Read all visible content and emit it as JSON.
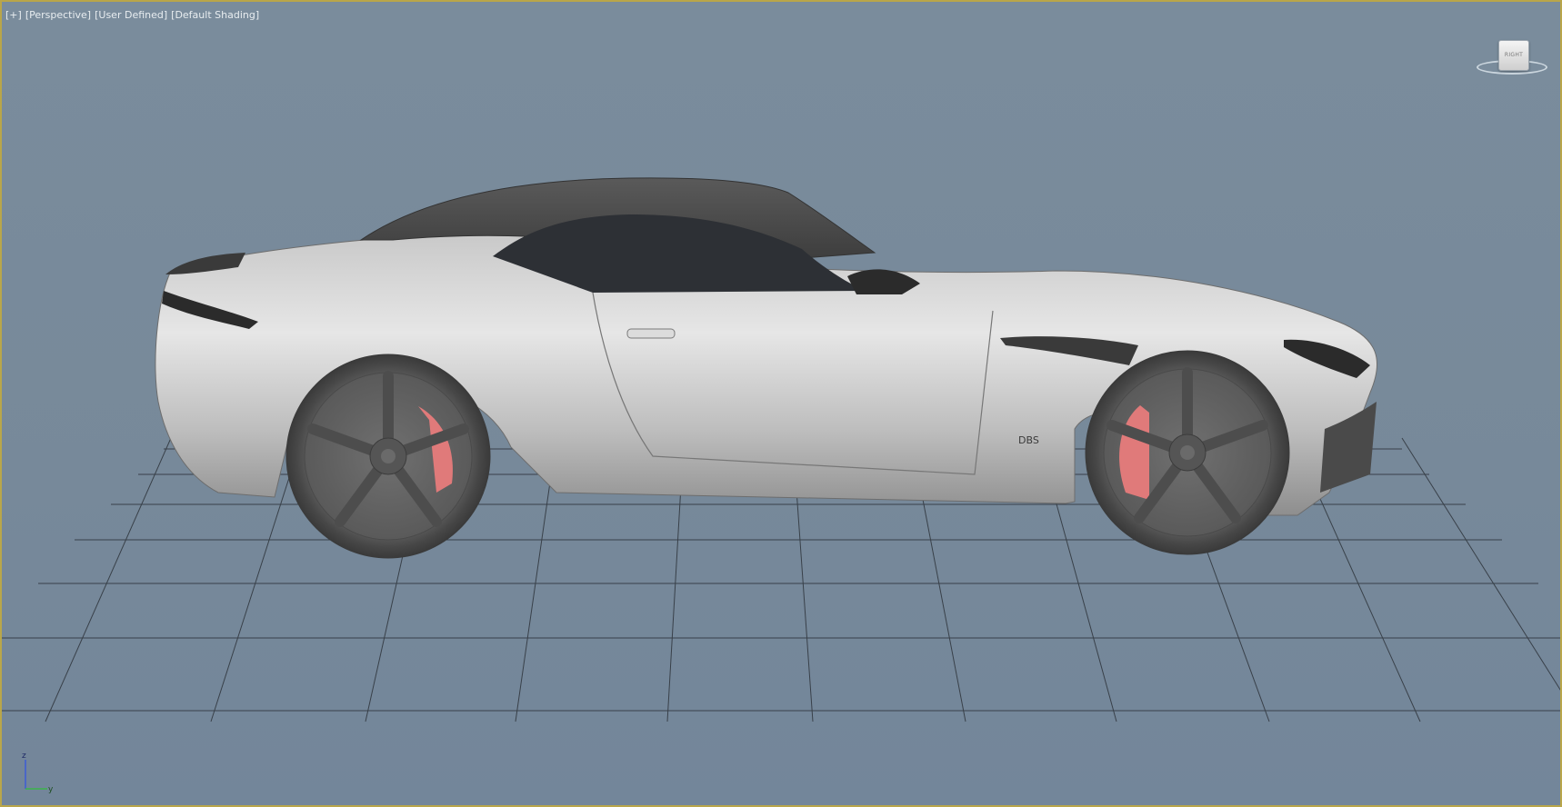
{
  "viewport": {
    "labels": [
      "[+]",
      "[Perspective]",
      "[User Defined]",
      "[Default Shading]"
    ]
  },
  "viewcube": {
    "face_label": "RIGHT"
  },
  "axis_gizmo": {
    "z_label": "z",
    "y_label": "y"
  },
  "model": {
    "badge_text": "DBS"
  },
  "icons": {
    "viewcube": "viewcube-icon",
    "axis": "axis-tripod-icon"
  },
  "colors": {
    "background": "#77899a",
    "viewport_border": "#b9a64a",
    "grid": "#2a2f35",
    "car_body": "#d8d8d8",
    "brake_caliper": "#e07a7a"
  }
}
